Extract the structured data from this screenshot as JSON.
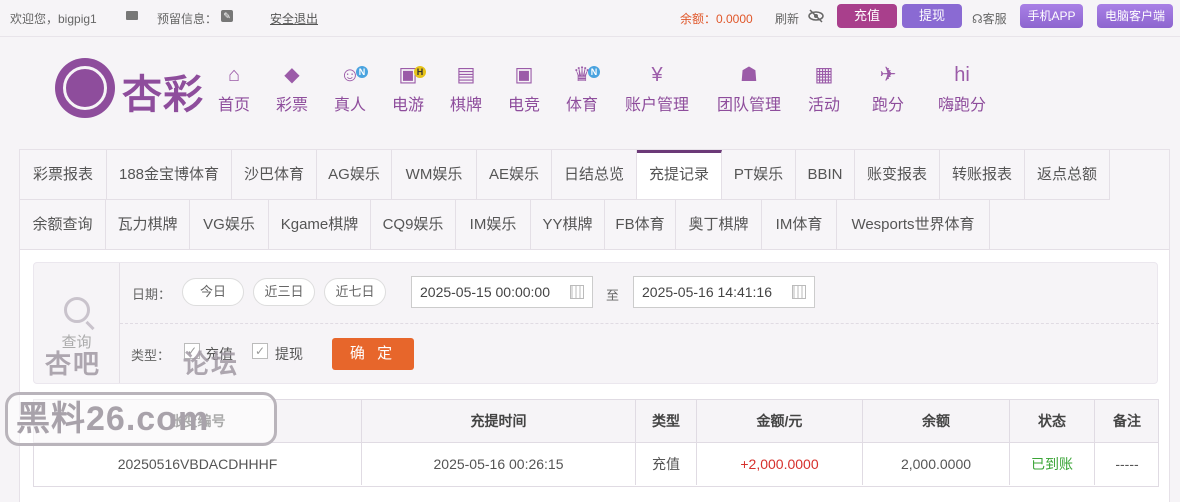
{
  "topbar": {
    "welcome": "欢迎您，bigpig1",
    "reserve_info": "预留信息：",
    "logout": "安全退出",
    "balance": "余额：0.0000",
    "refresh": "刷新",
    "charge": "充值",
    "withdraw": "提现",
    "service": "客服",
    "mobile_app": "手机APP",
    "pc_client": "电脑客户端"
  },
  "logo": {
    "text": "杏彩"
  },
  "nav": [
    {
      "label": "首页",
      "icon": "home-icon",
      "glyph": "⌂"
    },
    {
      "label": "彩票",
      "icon": "lottery-icon",
      "glyph": "◆"
    },
    {
      "label": "真人",
      "icon": "live-dealer-icon",
      "glyph": "☺",
      "badge": "N"
    },
    {
      "label": "电游",
      "icon": "gamepad-icon",
      "glyph": "▣",
      "badge": "H"
    },
    {
      "label": "棋牌",
      "icon": "cards-icon",
      "glyph": "▤"
    },
    {
      "label": "电竞",
      "icon": "esports-icon",
      "glyph": "▣"
    },
    {
      "label": "体育",
      "icon": "trophy-icon",
      "glyph": "♛",
      "badge": "N"
    },
    {
      "label": "账户管理",
      "icon": "yen-coin-icon",
      "glyph": "¥"
    },
    {
      "label": "团队管理",
      "icon": "team-icon",
      "glyph": "☗"
    },
    {
      "label": "活动",
      "icon": "gift-icon",
      "glyph": "▦"
    },
    {
      "label": "跑分",
      "icon": "running-score-icon",
      "glyph": "✈"
    },
    {
      "label": "嗨跑分",
      "icon": "hi-icon",
      "glyph": "hi"
    }
  ],
  "tabs_row1": [
    "彩票报表",
    "188金宝博体育",
    "沙巴体育",
    "AG娱乐",
    "WM娱乐",
    "AE娱乐",
    "日结总览",
    "充提记录",
    "PT娱乐",
    "BBIN",
    "账变报表",
    "转账报表",
    "返点总额"
  ],
  "tabs_row2": [
    "余额查询",
    "瓦力棋牌",
    "VG娱乐",
    "Kgame棋牌",
    "CQ9娱乐",
    "IM娱乐",
    "YY棋牌",
    "FB体育",
    "奥丁棋牌",
    "IM体育",
    "Wesports世界体育"
  ],
  "active_tab": "充提记录",
  "filter": {
    "search_label": "查询",
    "date_label": "日期：",
    "today": "今日",
    "last3": "近三日",
    "last7": "近七日",
    "start_date": "2025-05-15 00:00:00",
    "to": "至",
    "end_date": "2025-05-16 14:41:16",
    "type_label": "类型：",
    "type_charge": "充值",
    "type_withdraw": "提现",
    "confirm": "确 定"
  },
  "table": {
    "headers": [
      "账变编号",
      "充提时间",
      "类型",
      "金额/元",
      "余额",
      "状态",
      "备注"
    ],
    "rows": [
      [
        "20250516VBDACDHHHF",
        "2025-05-16 00:26:15",
        "充值",
        "+2,000.0000",
        "2,000.0000",
        "已到账",
        "-----"
      ]
    ]
  },
  "watermark": {
    "line1a": "杏吧",
    "line1b": "论坛",
    "line2": "黑料26.com"
  },
  "colors": {
    "brand": "#8e4d9c",
    "charge_btn": "#a93f8c",
    "withdraw_btn": "#8a6ad3",
    "confirm_btn": "#e7662b",
    "amount": "#d6302c",
    "status_ok": "#3aa436",
    "balance": "#e0572a"
  }
}
